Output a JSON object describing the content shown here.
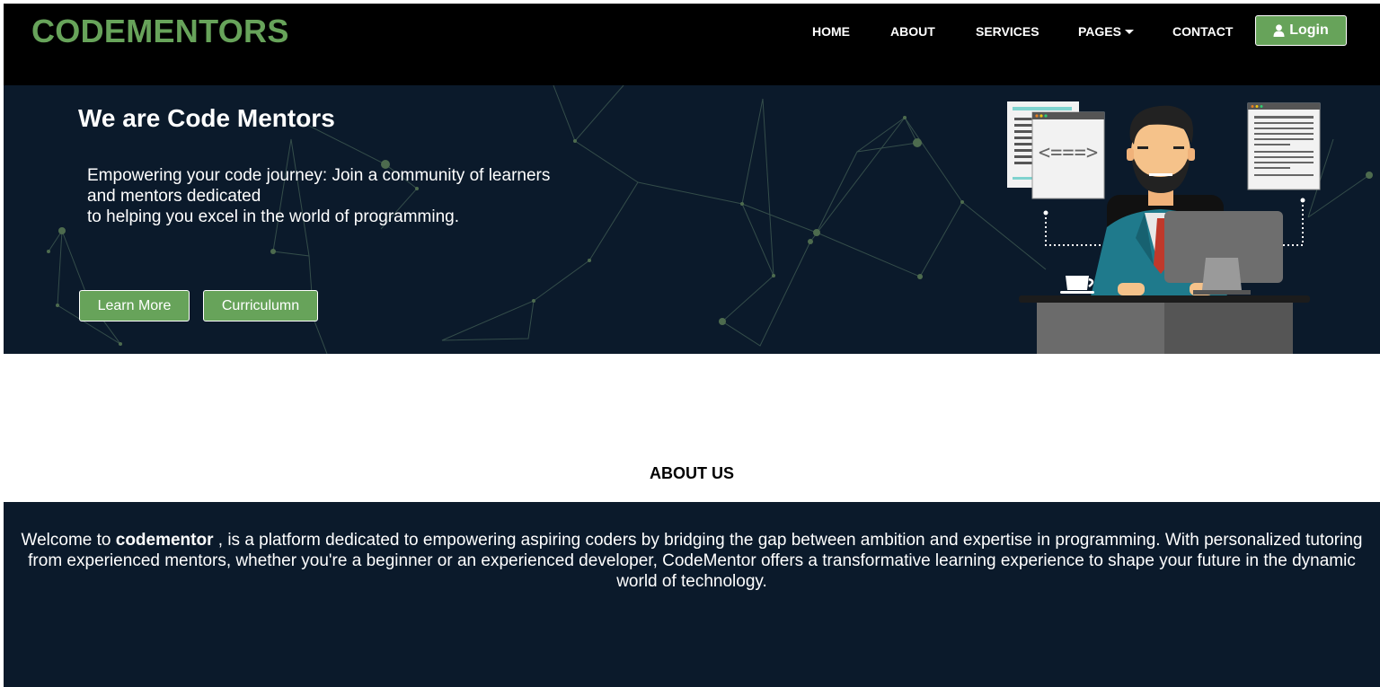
{
  "brand": {
    "name": "CODEMENTORS",
    "color": "#67a35a"
  },
  "nav": {
    "items": [
      {
        "label": "HOME"
      },
      {
        "label": "ABOUT"
      },
      {
        "label": "SERVICES"
      },
      {
        "label": "PAGES",
        "icon": "caret-down-icon"
      },
      {
        "label": "CONTACT"
      }
    ],
    "login": {
      "label": "Login",
      "icon": "user-icon"
    }
  },
  "hero": {
    "title": "We are Code Mentors",
    "lines": [
      "Empowering your code journey: Join a community of learners",
      "and mentors dedicated",
      "to helping you excel in the world of programming."
    ],
    "buttons": {
      "learn_more": "Learn More",
      "curriculum": "Curriculumn"
    },
    "illustration_code": "<===>",
    "background_color": "#0b1a2b"
  },
  "about": {
    "heading": "ABOUT US",
    "text_before": "Welcome to ",
    "text_bold": "codementor",
    "text_after": " , is a platform dedicated to empowering aspiring coders by bridging the gap between ambition and expertise in programming. With personalized tutoring from experienced mentors, whether you're a beginner or an experienced developer, CodeMentor offers a transformative learning experience to shape your future in the dynamic world of technology."
  }
}
